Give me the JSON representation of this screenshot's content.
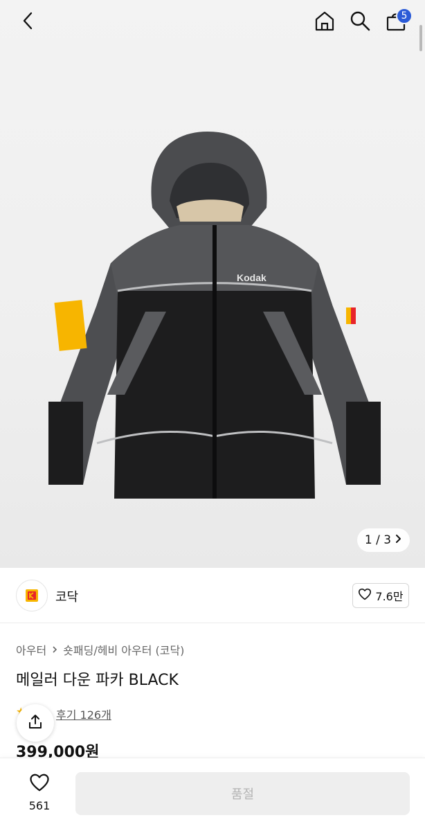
{
  "header": {
    "cart_count": "5"
  },
  "gallery": {
    "pager_text": "1 / 3",
    "jacket_logo_text": "Kodak"
  },
  "brand": {
    "name": "코닥",
    "likes": "7.6만"
  },
  "product": {
    "breadcrumb": [
      "아우터",
      "숏패딩/헤비 아우터 (코닥)"
    ],
    "title": "메일러 다운 파카 BLACK",
    "review_text": "후기 126개",
    "price": "399,000원"
  },
  "bottom": {
    "wish_count": "561",
    "soldout_label": "품절"
  },
  "colors": {
    "badge": "#2b5bd7",
    "kodak_red": "#e8242a",
    "kodak_yellow": "#f7b500",
    "star": "#f5b301"
  },
  "icons": [
    "back-arrow-icon",
    "home-icon",
    "search-icon",
    "shopping-bag-icon",
    "chevron-right-icon",
    "heart-icon",
    "share-icon",
    "star-icon"
  ]
}
